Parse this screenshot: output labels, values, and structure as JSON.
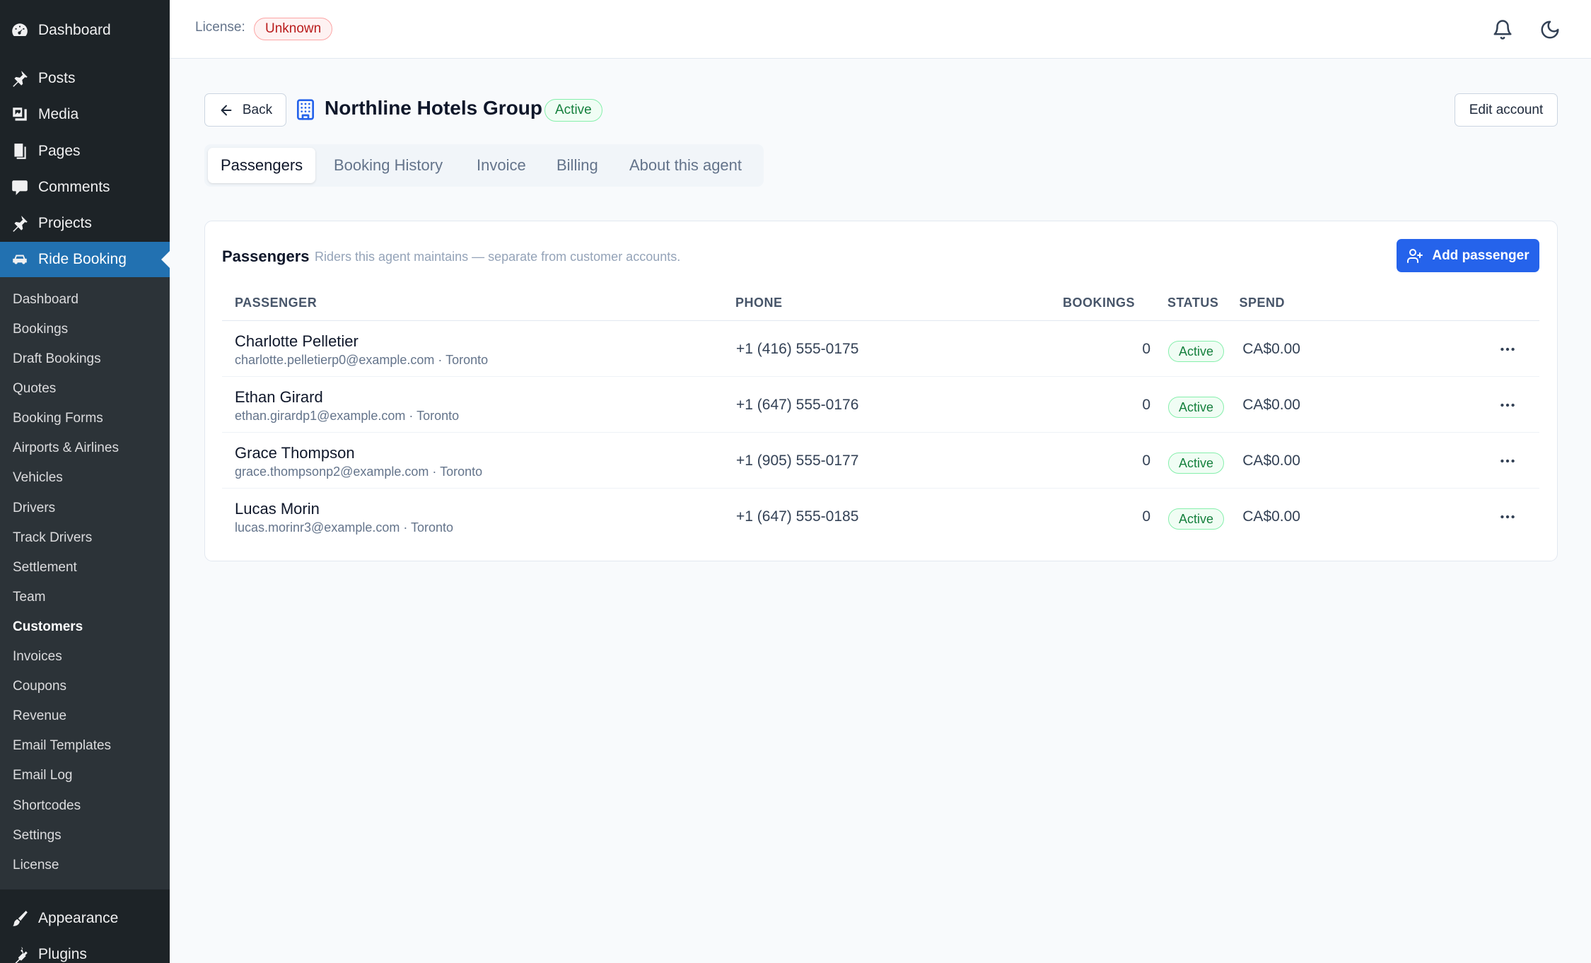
{
  "sidebar": {
    "top_items": [
      {
        "label": "Dashboard",
        "icon": "dashboard-icon"
      },
      {
        "label": "Posts",
        "icon": "pin-icon"
      },
      {
        "label": "Media",
        "icon": "media-icon"
      },
      {
        "label": "Pages",
        "icon": "pages-icon"
      },
      {
        "label": "Comments",
        "icon": "comment-icon"
      },
      {
        "label": "Projects",
        "icon": "pin-icon"
      },
      {
        "label": "Ride Booking",
        "icon": "car-icon"
      }
    ],
    "submenu": [
      "Dashboard",
      "Bookings",
      "Draft Bookings",
      "Quotes",
      "Booking Forms",
      "Airports & Airlines",
      "Vehicles",
      "Drivers",
      "Track Drivers",
      "Settlement",
      "Team",
      "Customers",
      "Invoices",
      "Coupons",
      "Revenue",
      "Email Templates",
      "Email Log",
      "Shortcodes",
      "Settings",
      "License"
    ],
    "bottom_items": [
      {
        "label": "Appearance",
        "icon": "brush-icon"
      },
      {
        "label": "Plugins",
        "icon": "plugin-icon"
      }
    ]
  },
  "topbar": {
    "license_label": "License:",
    "license_value": "Unknown"
  },
  "header": {
    "back_label": "Back",
    "title": "Northline Hotels Group",
    "status": "Active",
    "edit_label": "Edit account"
  },
  "tabs": [
    "Passengers",
    "Booking History",
    "Invoice",
    "Billing",
    "About this agent"
  ],
  "card": {
    "title": "Passengers",
    "subtitle": "Riders this agent maintains — separate from customer accounts.",
    "add_label": "Add passenger",
    "columns": {
      "passenger": "PASSENGER",
      "phone": "PHONE",
      "bookings": "BOOKINGS",
      "spend": "SPEND",
      "status": "STATUS"
    },
    "rows": [
      {
        "name": "Charlotte Pelletier",
        "email": "charlotte.pelletierp0@example.com · Toronto",
        "phone": "+1 (416) 555-0175",
        "bookings": "0",
        "spend": "CA$0.00",
        "status": "Active"
      },
      {
        "name": "Ethan Girard",
        "email": "ethan.girardp1@example.com · Toronto",
        "phone": "+1 (647) 555-0176",
        "bookings": "0",
        "spend": "CA$0.00",
        "status": "Active"
      },
      {
        "name": "Grace Thompson",
        "email": "grace.thompsonp2@example.com · Toronto",
        "phone": "+1 (905) 555-0177",
        "bookings": "0",
        "spend": "CA$0.00",
        "status": "Active"
      },
      {
        "name": "Lucas Morin",
        "email": "lucas.morinr3@example.com · Toronto",
        "phone": "+1 (647) 555-0185",
        "bookings": "0",
        "spend": "CA$0.00",
        "status": "Active"
      }
    ]
  }
}
